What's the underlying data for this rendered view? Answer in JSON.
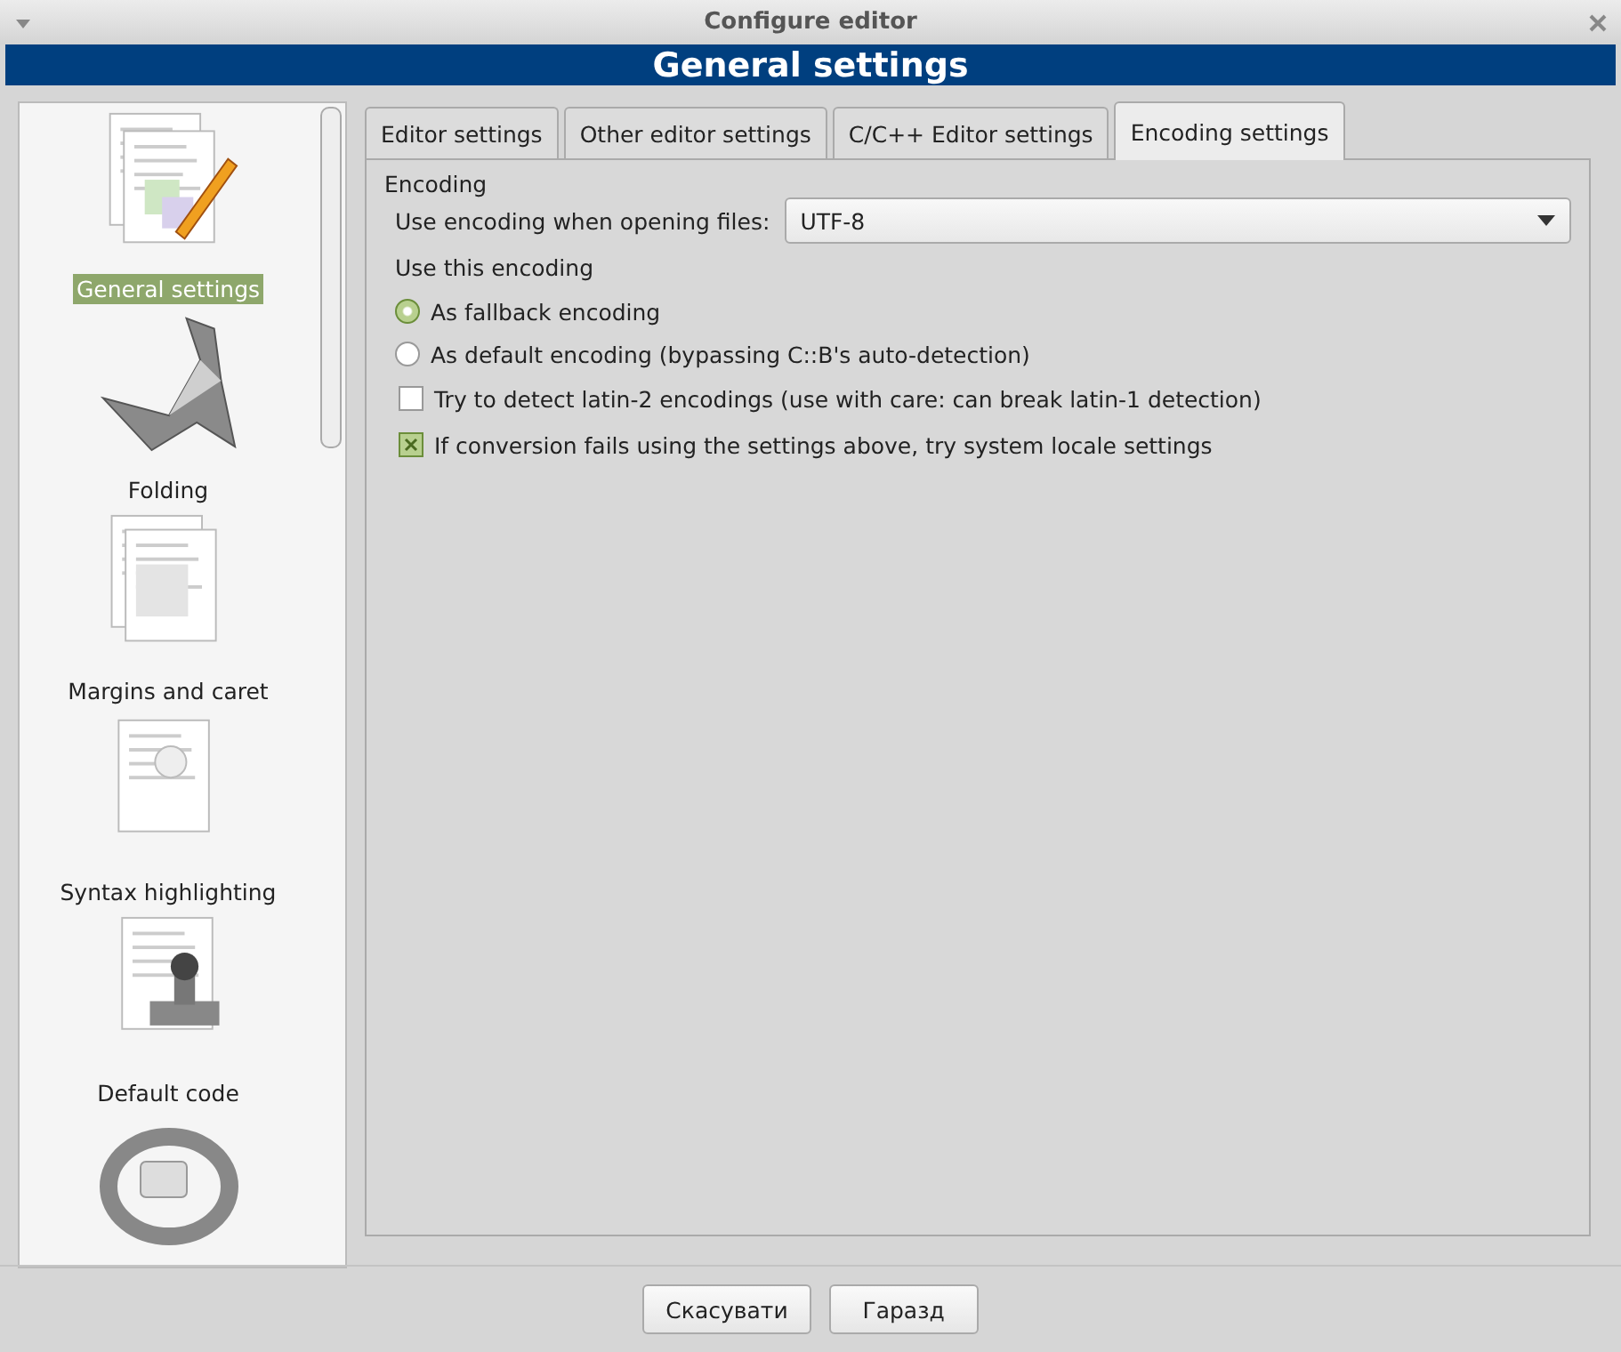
{
  "window": {
    "title": "Configure editor"
  },
  "header": {
    "title": "General settings"
  },
  "sidebar": {
    "items": [
      {
        "label": "General settings",
        "kind": "pencil",
        "selected": true
      },
      {
        "label": "Folding",
        "kind": "origami",
        "selected": false
      },
      {
        "label": "Margins and caret",
        "kind": "pages",
        "selected": false
      },
      {
        "label": "Syntax highlighting",
        "kind": "bulb",
        "selected": false
      },
      {
        "label": "Default code",
        "kind": "stamp",
        "selected": false
      },
      {
        "kind": "ring"
      }
    ]
  },
  "tabs": [
    {
      "label": "Editor settings",
      "selected": false
    },
    {
      "label": "Other editor settings",
      "selected": false
    },
    {
      "label": "C/C++ Editor settings",
      "selected": false
    },
    {
      "label": "Encoding settings",
      "selected": true
    }
  ],
  "encoding": {
    "group_label": "Encoding",
    "open_label": "Use encoding when opening files:",
    "open_value": "UTF-8",
    "use_label": "Use this encoding",
    "radios": [
      {
        "label": "As fallback encoding",
        "selected": true
      },
      {
        "label": "As default encoding (bypassing C::B's auto-detection)",
        "selected": false
      }
    ],
    "checkboxes": [
      {
        "label": "Try to detect latin-2 encodings (use with care: can break latin-1 detection)",
        "checked": false
      },
      {
        "label": "If conversion fails using the settings above, try system locale settings",
        "checked": true
      }
    ]
  },
  "buttons": [
    "Скасувати",
    "Гаразд"
  ]
}
